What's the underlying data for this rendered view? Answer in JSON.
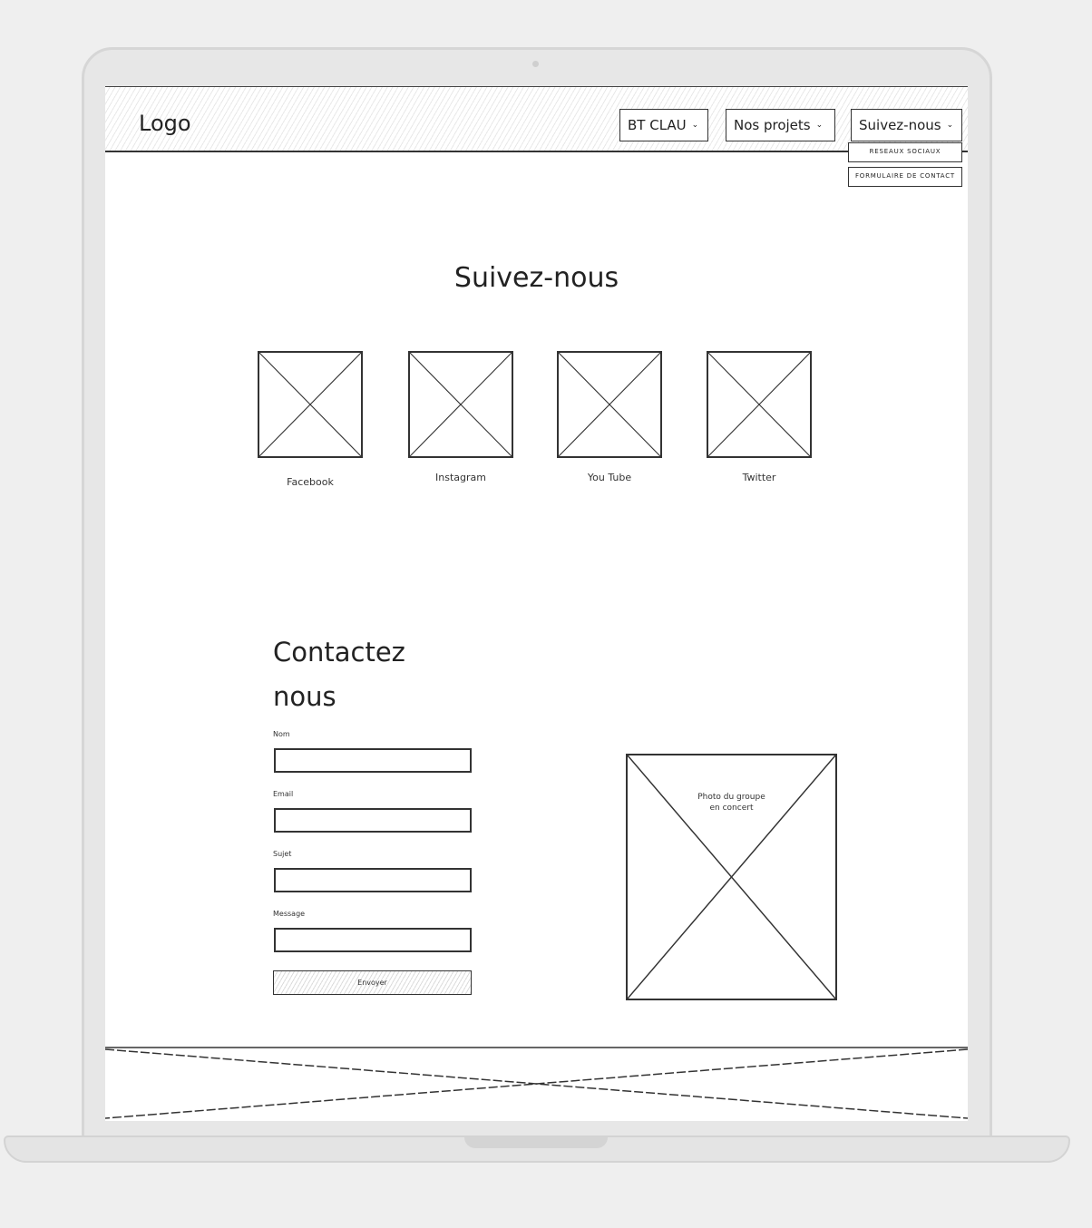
{
  "header": {
    "logo": "Logo",
    "nav": [
      {
        "label": "BT CLAU"
      },
      {
        "label": "Nos projets"
      },
      {
        "label": "Suivez-nous"
      }
    ],
    "submenu": [
      {
        "label": "RESEAUX SOCIAUX"
      },
      {
        "label": "FORMULAIRE DE CONTACT"
      }
    ]
  },
  "follow": {
    "title": "Suivez-nous",
    "networks": [
      {
        "label": "Facebook"
      },
      {
        "label": "Instagram"
      },
      {
        "label": "You Tube"
      },
      {
        "label": "Twitter"
      }
    ]
  },
  "contact": {
    "title_line1": "Contactez",
    "title_line2": "nous",
    "fields": [
      {
        "label": "Nom",
        "value": ""
      },
      {
        "label": "Email",
        "value": ""
      },
      {
        "label": "Sujet",
        "value": ""
      },
      {
        "label": "Message",
        "value": ""
      }
    ],
    "submit_label": "Envoyer",
    "photo_caption_line1": "Photo du groupe",
    "photo_caption_line2": "en concert"
  }
}
